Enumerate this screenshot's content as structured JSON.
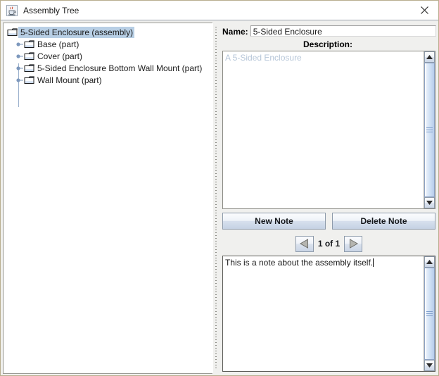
{
  "window": {
    "title": "Assembly Tree",
    "icon": "java-coffee-cup-icon",
    "close_label": "✕"
  },
  "tree": {
    "root": {
      "label": "5-Sided Enclosure (assembly)",
      "selected": true,
      "icon": "folder-icon"
    },
    "children": [
      {
        "label": "Base (part)",
        "icon": "folder-icon",
        "handle": "expand-handle-icon"
      },
      {
        "label": "Cover (part)",
        "icon": "folder-icon",
        "handle": "expand-handle-icon"
      },
      {
        "label": "5-Sided Enclosure Bottom Wall Mount (part)",
        "icon": "folder-icon",
        "handle": "expand-handle-icon"
      },
      {
        "label": "Wall Mount (part)",
        "icon": "folder-icon",
        "handle": "expand-handle-icon"
      }
    ]
  },
  "detail": {
    "name_label": "Name:",
    "name_value": "5-Sided Enclosure",
    "name_placeholder": "Name",
    "description_label": "Description:",
    "description_value": "A 5-Sided Enclosure",
    "buttons": {
      "new_note": "New Note",
      "delete_note": "Delete Note"
    },
    "pager": {
      "prev_icon": "triangle-left-icon",
      "next_icon": "triangle-right-icon",
      "indicator": "1 of 1"
    },
    "note_value": "This is a note about the assembly itself."
  },
  "colors": {
    "selection": "#b8cfe5",
    "panel_bg": "#f0f0ee",
    "window_border": "#b8ae8f",
    "placeholder_text": "#b6c6d8"
  }
}
